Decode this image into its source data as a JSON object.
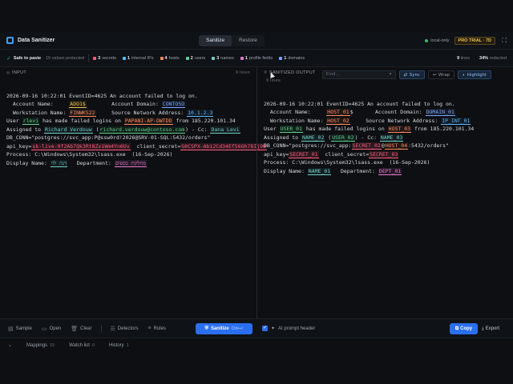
{
  "app": {
    "title": "Data Sanitizer",
    "modes": [
      "Sanitize",
      "Restore"
    ],
    "active_mode": "Sanitize",
    "env_label": "local-only",
    "pro_badge": "PRO TRIAL · 7D",
    "accent_color": "#2a6ff0"
  },
  "stats": {
    "safe_label": "Safe to paste",
    "safe_sub": "15 values protected",
    "categories": [
      {
        "count": "3",
        "label": "secrets",
        "color": "#ff5c7c"
      },
      {
        "count": "1",
        "label": "internal IPs",
        "color": "#5cb8ff"
      },
      {
        "count": "4",
        "label": "hosts",
        "color": "#ff8a5c"
      },
      {
        "count": "2",
        "label": "users",
        "color": "#5fd38a"
      },
      {
        "count": "3",
        "label": "names",
        "color": "#6fd0c8"
      },
      {
        "count": "1",
        "label": "profile fields",
        "color": "#e77ad0"
      },
      {
        "count": "1",
        "label": "domains",
        "color": "#7aa6ff"
      }
    ],
    "lines_count": "9",
    "lines_label": "lines",
    "redacted_pct": "34%",
    "redacted_label": "redacted"
  },
  "input": {
    "title": "INPUT",
    "meta": "9 lines",
    "l1": "2026-09-16 10:22:01 EventID=4625 An account failed to log on.",
    "l2_a": "  Account Name:     ",
    "l2_acct": "ADO1$",
    "l2_b": "        Account Domain: ",
    "l2_dom": "CONTOSO",
    "l3_a": "  Workstation Name: ",
    "l3_host": "FINWKS22",
    "l3_b": "     Source Network Address: ",
    "l3_ip": "10.1.2.3",
    "l4_a": "User ",
    "l4_user": "rlevi",
    "l4_b": " has made failed logins on ",
    "l4_host": "PAPANI-AP-OWTDD",
    "l4_c": " from 185.220.101.34",
    "l5_a": "Assigned to ",
    "l5_name1": "Richard Verdouw",
    "l5_b": " (",
    "l5_email": "richard.verdouw@contoso.com",
    "l5_c": ") - Cc: ",
    "l5_name2": "Dana Levi",
    "l6_a": "DB_CONN=\"postgres://svc_app:P@ssw0rd!2026@SRV-01-SQL:5432/orders\"",
    "l7_a": "api_key=",
    "l7_secret": "sk-live-9f2Ab7Qk3Rt8Zx1Wm4Yn6Uv",
    "l7_b": "  client_secret=",
    "l7_secret2": "G0CSPX-Ab12Cd34Ef56Gh78Ij90",
    "l8": "Process: C:\\Windows\\System32\\lsass.exe  (16-Sep-2026)",
    "l9_a": "Display Name: ",
    "l9_name": "דנה לוי",
    "l9_b": "   Department: ",
    "l9_dept": "מחלקת כספים"
  },
  "output": {
    "title": "SANITIZED OUTPUT",
    "meta": "9 lines",
    "find_placeholder": "Find...",
    "sync_label": "Sync",
    "wrap_label": "Wrap",
    "highlight_label": "Highlight",
    "l1": "2026-09-16 10:22:01 EventID=4625 An account failed to log on.",
    "l2_a": "  Account Name:     ",
    "l2_host": "HOST_01",
    "l2_b": "$       Account Domain: ",
    "l2_dom": "DOMAIN_01",
    "l3_a": "  Workstation Name: ",
    "l3_host": "HOST_02",
    "l3_b": "     Source Network Address: ",
    "l3_ip": "IP_INT_01",
    "l4_a": "User ",
    "l4_user": "USER_01",
    "l4_b": " has made failed logins on ",
    "l4_host": "HOST_03",
    "l4_c": " from 185.220.101.34",
    "l5_a": "Assigned to ",
    "l5_name1": "NAME_02",
    "l5_b": " (",
    "l5_user": "USER_02",
    "l5_c": ") - Cc: ",
    "l5_name2": "NAME_03",
    "l6_a": "DB_CONN=\"postgres://svc_app:",
    "l6_secret": "SECRET_02",
    "l6_b": "@",
    "l6_host": "HOST_04",
    "l6_c": ":5432/orders\"",
    "l7_a": "api_key=",
    "l7_secret": "SECRET_01",
    "l7_b": "  client_secret=",
    "l7_secret2": "SECRET_03",
    "l8": "Process: C:\\Windows\\System32\\lsass.exe  (16-Sep-2026)",
    "l9_a": "Display Name: ",
    "l9_name": "NAME_01",
    "l9_b": "   Department: ",
    "l9_dept": "DEPT_01"
  },
  "toolbar": {
    "sample": "Sample",
    "open": "Open",
    "clear": "Clear",
    "detectors": "Detectors",
    "rules": "Rules",
    "sanitize": "Sanitize",
    "sanitize_kbd": "Ctrl+↵",
    "ai_prompt": "AI prompt header",
    "copy": "Copy",
    "export": "Export"
  },
  "footer": {
    "mappings": "Mappings",
    "mappings_count": "15",
    "watchlist": "Watch list",
    "watchlist_count": "0",
    "history": "History",
    "history_count": "1"
  }
}
